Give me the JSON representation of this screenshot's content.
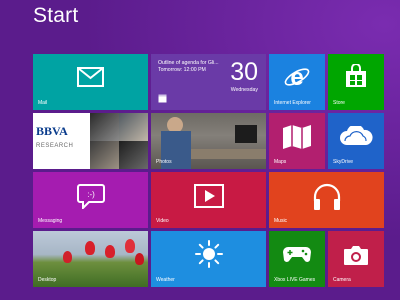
{
  "header": {
    "title": "Start"
  },
  "tiles": {
    "mail": {
      "label": "Mail",
      "color": "#00a3a3"
    },
    "calendar": {
      "label": "",
      "line1": "Outline of agenda for Gli...",
      "line2": "Tomorrow: 12:00 PM",
      "day": "30",
      "weekday": "Wednesday",
      "color": "#6a3aa7"
    },
    "ie": {
      "label": "Internet Explorer",
      "color": "#1b82e0"
    },
    "store": {
      "label": "Store",
      "color": "#00a600"
    },
    "people": {
      "bbva_logo": "BBVA",
      "bbva_sub": "RESEARCH",
      "color": "#ffffff"
    },
    "photos": {
      "label": "Photos",
      "color": "#4a4642"
    },
    "maps": {
      "label": "Maps",
      "color": "#b21f6f"
    },
    "skydrive": {
      "label": "SkyDrive",
      "color": "#1f63c9"
    },
    "messaging": {
      "label": "Messaging",
      "color": "#a51cb0"
    },
    "video": {
      "label": "Video",
      "color": "#c81a44"
    },
    "music": {
      "label": "Music",
      "color": "#e1431e"
    },
    "desktop": {
      "label": "Desktop",
      "color": "#6d8f3e"
    },
    "weather": {
      "label": "Weather",
      "color": "#1e8ee0"
    },
    "xbox": {
      "label": "Xbox LIVE Games",
      "color": "#138a12"
    },
    "camera": {
      "label": "Camera",
      "color": "#c01f4a"
    }
  },
  "icons": {
    "mail": "envelope-icon",
    "calendar": "calendar-icon",
    "ie": "internet-explorer-icon",
    "store": "shopping-bag-icon",
    "maps": "folded-map-icon",
    "skydrive": "cloud-icon",
    "messaging": "speech-bubble-icon",
    "video": "play-icon",
    "music": "headphones-icon",
    "weather": "sun-icon",
    "xbox": "game-controller-icon",
    "camera": "camera-icon"
  }
}
